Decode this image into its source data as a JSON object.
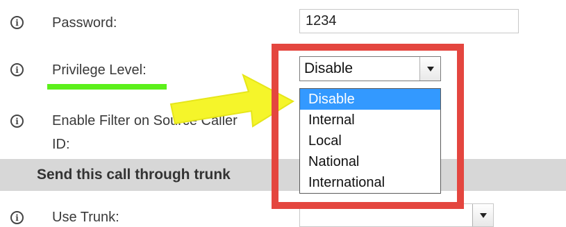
{
  "form": {
    "password": {
      "label": "Password:",
      "value": "1234"
    },
    "privilege": {
      "label": "Privilege Level:",
      "selected": "Disable"
    },
    "filter": {
      "label_line1": "Enable Filter on Source Caller",
      "label_line2": "ID:"
    },
    "section_title": "Send this call through trunk",
    "use_trunk": {
      "label": "Use Trunk:"
    }
  },
  "dropdown": {
    "options": [
      "Disable",
      "Internal",
      "Local",
      "National",
      "International"
    ],
    "highlighted": "Disable"
  },
  "annotations": {
    "box_color": "#e4463f",
    "arrow_color": "#f5f52a",
    "underline_color": "#5cf01b"
  }
}
